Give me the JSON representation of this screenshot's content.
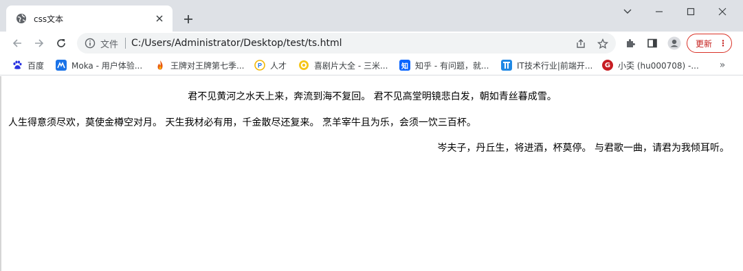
{
  "tab": {
    "title": "css文本",
    "favicon": "globe-icon"
  },
  "window_controls": [
    "chevron-down-icon",
    "minimize-icon",
    "maximize-icon",
    "close-icon"
  ],
  "omnibox": {
    "scheme_label": "文件",
    "url": "C:/Users/Administrator/Desktop/test/ts.html"
  },
  "update_button": {
    "label": "更新"
  },
  "bookmarks": [
    {
      "label": "百度",
      "icon": "baidu-paw-icon",
      "color": "#2932e1"
    },
    {
      "label": "Moka - 用户体验...",
      "icon": "moka-icon",
      "color": "#1a73e8"
    },
    {
      "label": "王牌对王牌第七季...",
      "icon": "flame-icon",
      "color": "#e8590c"
    },
    {
      "label": "人才",
      "icon": "rencai-icon",
      "color": "#f2b705"
    },
    {
      "label": "喜剧片大全 - 三米...",
      "icon": "smile-icon",
      "color": "#f5c518"
    },
    {
      "label": "知乎 - 有问题，就...",
      "icon": "zhihu-icon",
      "color": "#0a66ff"
    },
    {
      "label": "IT技术行业|前端开...",
      "icon": "it-icon",
      "color": "#1e88e5"
    },
    {
      "label": "小奀 (hu000708) -...",
      "icon": "gitee-icon",
      "color": "#c71d23"
    }
  ],
  "page": {
    "line1": "君不见黄河之水天上来，奔流到海不复回。 君不见高堂明镜悲白发，朝如青丝暮成雪。",
    "line2": "人生得意须尽欢，莫使金樽空对月。 天生我材必有用，千金散尽还复来。 烹羊宰牛且为乐，会须一饮三百杯。",
    "line3": "岑夫子，丹丘生，将进酒，杯莫停。 与君歌一曲，请君为我倾耳听。"
  }
}
